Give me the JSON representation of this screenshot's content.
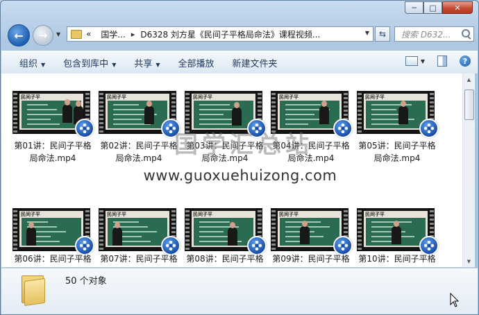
{
  "window": {
    "buttons": {
      "minimize": "─",
      "maximize": "□",
      "close": "✕"
    }
  },
  "nav": {
    "back_icon": "arrow-left-icon",
    "forward_icon": "arrow-right-icon",
    "address": {
      "chevron": "«",
      "crumb1": "国学...",
      "separator": "▸",
      "crumb2": "D6328 刘方星《民间子平格局命法》课程视频..."
    },
    "search_placeholder": "搜索 D632..."
  },
  "toolbar": {
    "organize": "组织",
    "include_in_library": "包含到库中",
    "share": "共享",
    "play_all": "全部播放",
    "new_folder": "新建文件夹"
  },
  "files": [
    {
      "line1": "第01讲：民间子平格",
      "line2": "局命法.mp4"
    },
    {
      "line1": "第02讲：民间子平格",
      "line2": "局命法.mp4"
    },
    {
      "line1": "第03讲：民间子平格",
      "line2": "局命法.mp4"
    },
    {
      "line1": "第04讲：民间子平格",
      "line2": "局命法.mp4"
    },
    {
      "line1": "第05讲：民间子平格",
      "line2": "局命法.mp4"
    },
    {
      "line1": "第06讲：民间子平格",
      "line2": ""
    },
    {
      "line1": "第07讲：民间子平格",
      "line2": ""
    },
    {
      "line1": "第08讲：民间子平格",
      "line2": ""
    },
    {
      "line1": "第09讲：民间子平格",
      "line2": ""
    },
    {
      "line1": "第10讲：民间子平格",
      "line2": ""
    }
  ],
  "thumbnail_logo": "民间子平",
  "watermark": {
    "title": "国学汇总站",
    "url": "www.guoxuehuizong.com"
  },
  "details": {
    "count": "50 个对象"
  },
  "colors": {
    "toolbar_text": "#1e395b",
    "chalkboard": "#2a6b51",
    "badge_blue": "#1448a6"
  }
}
